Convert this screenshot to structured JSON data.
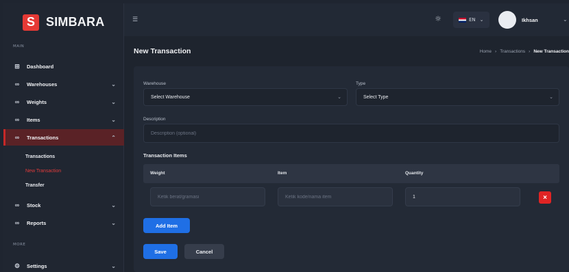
{
  "brand": {
    "logo_letter": "S",
    "name": "SIMBARA"
  },
  "sidebar": {
    "section_main": "MAIN",
    "section_more": "MORE",
    "items": [
      {
        "label": "Dashboard",
        "icon": "dashboard-icon"
      },
      {
        "label": "Warehouses",
        "icon": "link-icon"
      },
      {
        "label": "Weights",
        "icon": "link-icon"
      },
      {
        "label": "Items",
        "icon": "link-icon"
      },
      {
        "label": "Transactions",
        "icon": "link-icon",
        "active": true
      },
      {
        "label": "Stock",
        "icon": "link-icon"
      },
      {
        "label": "Reports",
        "icon": "link-icon"
      },
      {
        "label": "Settings",
        "icon": "gear-icon"
      }
    ],
    "sub_items": [
      "Transactions",
      "New Transaction",
      "Transfer"
    ]
  },
  "topbar": {
    "lang": "EN",
    "username": "Ikhsan"
  },
  "page": {
    "title": "New Transaction",
    "breadcrumb": [
      "Home",
      "Transactions",
      "New Transaction"
    ]
  },
  "form": {
    "warehouse_label": "Warehouse",
    "warehouse_value": "Select Warehouse",
    "type_label": "Type",
    "type_value": "Select Type",
    "description_label": "Description",
    "description_placeholder": "Description (optional)",
    "items_title": "Transaction Items",
    "columns": [
      "Weight",
      "Item",
      "Quantity"
    ],
    "row": {
      "weight_placeholder": "Ketik berat/gramasi",
      "item_placeholder": "Ketik kode/nama item",
      "quantity_value": "1",
      "delete_label": "×"
    },
    "add_item_label": "Add Item",
    "save_label": "Save",
    "cancel_label": "Cancel"
  },
  "colors": {
    "accent": "#e53935",
    "primary": "#1f6fe5",
    "background": "#1e242e"
  }
}
